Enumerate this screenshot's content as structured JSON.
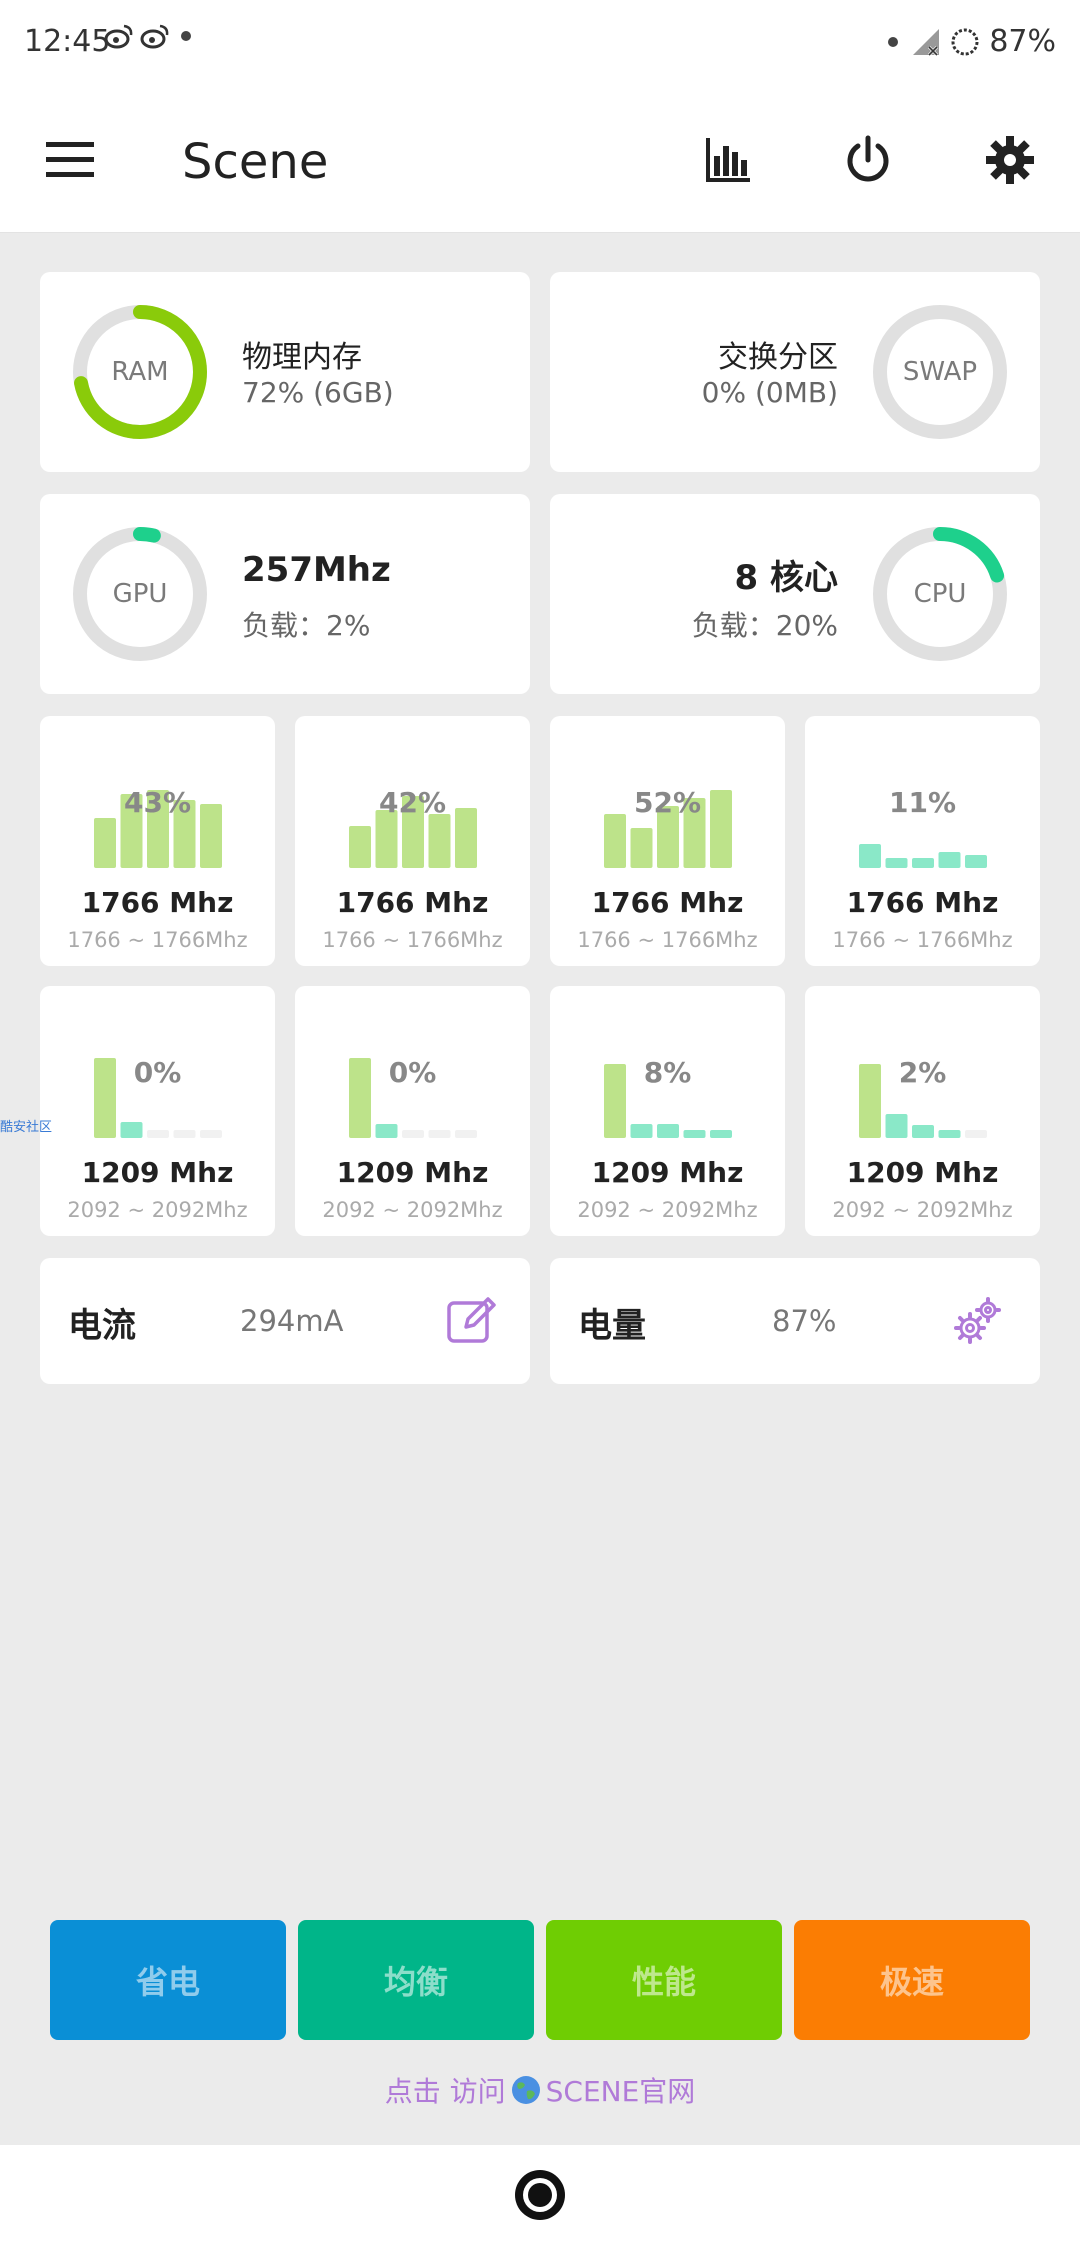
{
  "status_bar": {
    "time": "12:45",
    "battery": "87%",
    "icons": [
      "weibo-icon",
      "weibo-icon",
      "dot-icon",
      "signal-icon",
      "battery-ring-icon"
    ]
  },
  "app_bar": {
    "title": "Scene",
    "actions": [
      "chart-icon",
      "power-icon",
      "gear-icon"
    ]
  },
  "memory": {
    "ram": {
      "label": "RAM",
      "title": "物理内存",
      "detail": "72% (6GB)",
      "percent": 72,
      "color": "#8acb0a"
    },
    "swap": {
      "label": "SWAP",
      "title": "交换分区",
      "detail": "0% (0MB)",
      "percent": 0,
      "color": "#8acb0a"
    }
  },
  "processors": {
    "gpu": {
      "label": "GPU",
      "freq": "257Mhz",
      "load": "负载：2%",
      "percent": 2,
      "color": "#1ed08c"
    },
    "cpu": {
      "label": "CPU",
      "cores": "8 核心",
      "load": "负载：20%",
      "percent": 20,
      "color": "#1ed08c"
    }
  },
  "cores": [
    {
      "pct": "43%",
      "freq": "1766 Mhz",
      "range": "1766 ~ 1766Mhz",
      "levels": [
        0.62,
        0.92,
        0.98,
        0.85,
        0.8
      ]
    },
    {
      "pct": "42%",
      "freq": "1766 Mhz",
      "range": "1766 ~ 1766Mhz",
      "levels": [
        0.52,
        0.72,
        0.9,
        0.68,
        0.75
      ]
    },
    {
      "pct": "52%",
      "freq": "1766 Mhz",
      "range": "1766 ~ 1766Mhz",
      "levels": [
        0.68,
        0.5,
        0.78,
        0.88,
        0.98
      ]
    },
    {
      "pct": "11%",
      "freq": "1766 Mhz",
      "range": "1766 ~ 1766Mhz",
      "levels": [
        0.3,
        0.12,
        0.12,
        0.2,
        0.16
      ]
    },
    {
      "pct": "0%",
      "freq": "1209 Mhz",
      "range": "2092 ~ 2092Mhz",
      "levels": [
        1.0,
        0.2,
        0.0,
        0.0,
        0.0
      ]
    },
    {
      "pct": "0%",
      "freq": "1209 Mhz",
      "range": "2092 ~ 2092Mhz",
      "levels": [
        1.0,
        0.18,
        0.0,
        0.0,
        0.0
      ]
    },
    {
      "pct": "8%",
      "freq": "1209 Mhz",
      "range": "2092 ~ 2092Mhz",
      "levels": [
        0.92,
        0.18,
        0.18,
        0.1,
        0.1
      ]
    },
    {
      "pct": "2%",
      "freq": "1209 Mhz",
      "range": "2092 ~ 2092Mhz",
      "levels": [
        0.92,
        0.3,
        0.16,
        0.08,
        0.0
      ]
    }
  ],
  "battery": {
    "current": {
      "label": "电流",
      "value": "294mA"
    },
    "level": {
      "label": "电量",
      "value": "87%"
    }
  },
  "side_label": "酷安社区",
  "modes": [
    {
      "label": "省电",
      "color": "#0a8fd6"
    },
    {
      "label": "均衡",
      "color": "#00b589"
    },
    {
      "label": "性能",
      "color": "#6fcd03"
    },
    {
      "label": "极速",
      "color": "#fb7d03"
    }
  ],
  "footer": {
    "prefix": "点击 访问",
    "link": "SCENE官网"
  }
}
